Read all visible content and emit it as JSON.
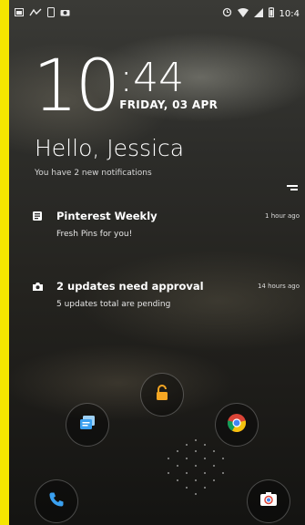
{
  "status_bar": {
    "time": "10:4",
    "left_icons": [
      "gallery-icon",
      "nav-icon",
      "phone-icon",
      "camera-icon"
    ],
    "right_icons": [
      "alarm-icon",
      "wifi-icon",
      "signal-icon",
      "battery-icon"
    ]
  },
  "lockscreen": {
    "clock_hour": "10",
    "clock_minutes": ":44",
    "date": "FRIDAY, 03 APR",
    "greeting": "Hello, Jessica",
    "subgreeting": "You have 2 new notifications"
  },
  "notifications": [
    {
      "icon": "pinterest-notification-icon",
      "title": "Pinterest Weekly",
      "time": "1 hour ago",
      "body": "Fresh Pins for you!"
    },
    {
      "icon": "updates-notification-icon",
      "title": "2 updates need approval",
      "time": "14 hours ago",
      "body": "5 updates total are pending"
    }
  ],
  "shortcuts": [
    "unlock-icon",
    "messages-icon",
    "chrome-icon",
    "phone-icon",
    "camera-icon"
  ],
  "colors": {
    "frame": "#f5e600",
    "unlock": "#f5a623",
    "accent_blue": "#3aa0f0"
  }
}
